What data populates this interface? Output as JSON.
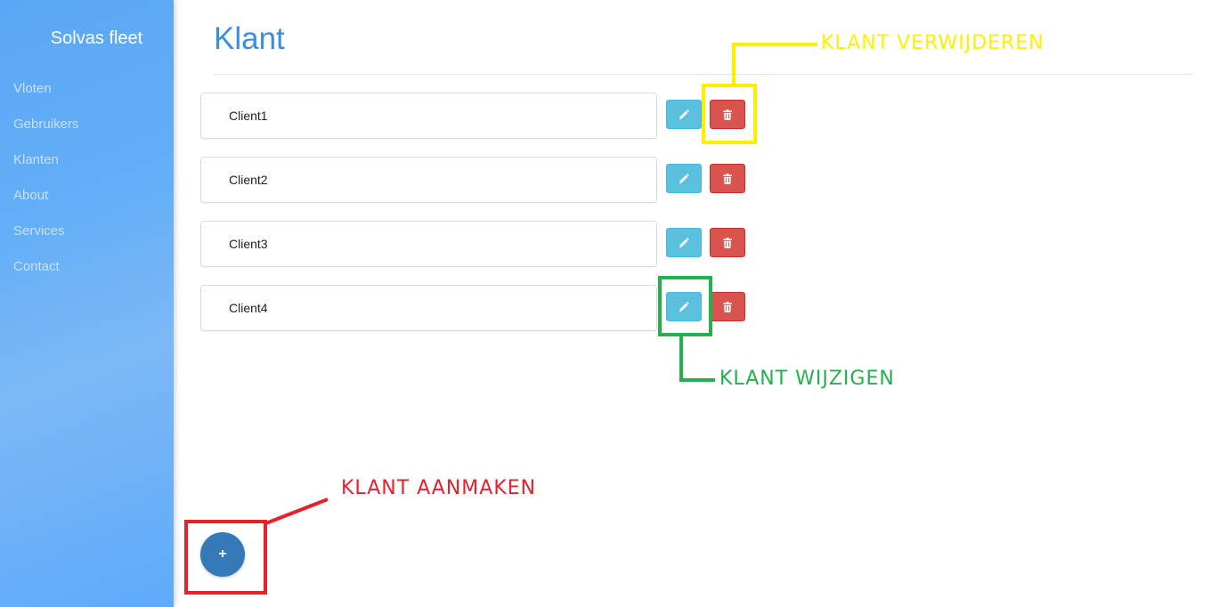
{
  "app": {
    "brand": "Solvas fleet"
  },
  "sidebar": {
    "items": [
      {
        "label": "Vloten"
      },
      {
        "label": "Gebruikers"
      },
      {
        "label": "Klanten"
      },
      {
        "label": "About"
      },
      {
        "label": "Services"
      },
      {
        "label": "Contact"
      }
    ]
  },
  "main": {
    "title": "Klant",
    "clients": [
      {
        "name": "Client1"
      },
      {
        "name": "Client2"
      },
      {
        "name": "Client3"
      },
      {
        "name": "Client4"
      }
    ],
    "add_button_label": "+"
  },
  "annotations": {
    "delete": {
      "label": "KLANT VERWIJDEREN",
      "color": "#ffee00"
    },
    "edit": {
      "label": "KLANT WIJZIGEN",
      "color": "#22b14c"
    },
    "create": {
      "label": "KLANT AANMAKEN",
      "color": "#e8202a"
    }
  },
  "colors": {
    "accent": "#3c8ddc",
    "edit_button": "#5bc0de",
    "delete_button": "#d9534f",
    "fab": "#337ab7"
  },
  "icons": {
    "edit": "pencil-icon",
    "delete": "trash-icon"
  }
}
